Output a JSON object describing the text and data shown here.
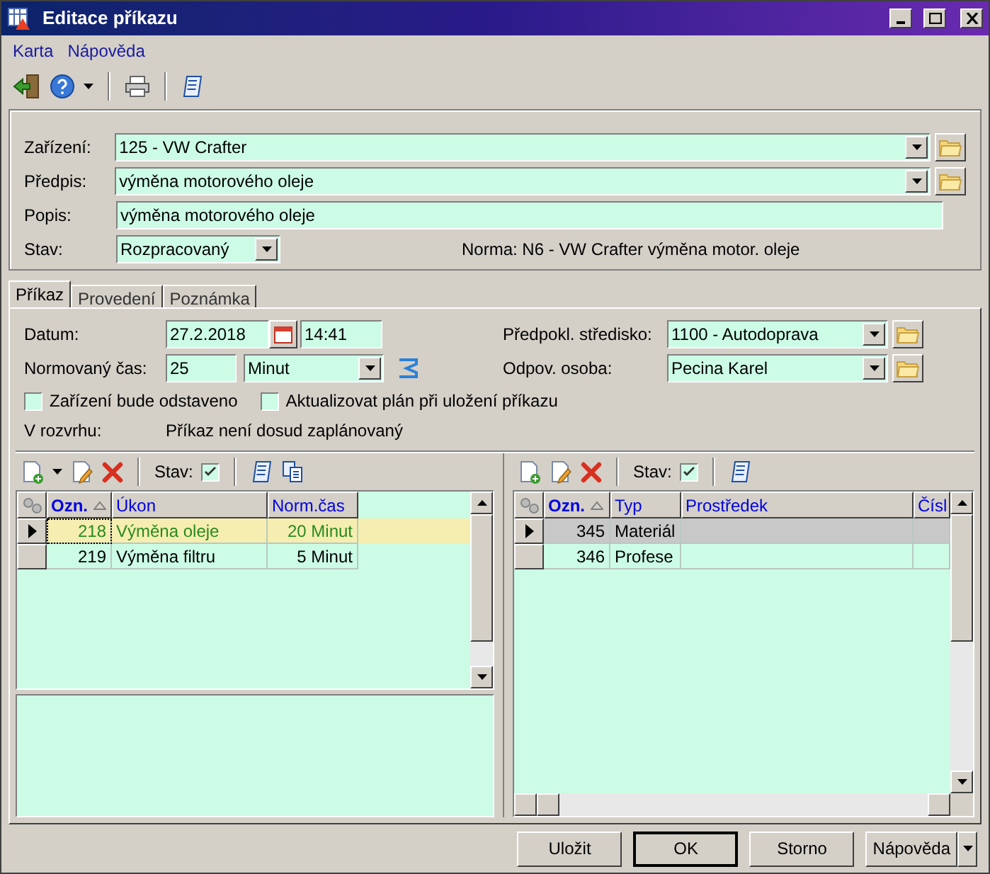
{
  "window": {
    "title": "Editace příkazu"
  },
  "menu": [
    {
      "label": "Karta"
    },
    {
      "label": "Nápověda"
    }
  ],
  "header": {
    "fields": [
      {
        "label": "Zařízení:",
        "value": "125 - VW Crafter",
        "kind": "combo_browse"
      },
      {
        "label": "Předpis:",
        "value": "výměna motorového oleje",
        "kind": "combo_browse"
      },
      {
        "label": "Popis:",
        "value": "výměna motorového oleje",
        "kind": "text"
      }
    ],
    "status": {
      "label": "Stav:",
      "value": "Rozpracovaný"
    },
    "norm": "Norma: N6 - VW Crafter výměna motor. oleje"
  },
  "tabs": [
    {
      "label": "Příkaz",
      "selected": true
    },
    {
      "label": "Provedení",
      "selected": false
    },
    {
      "label": "Poznámka",
      "selected": false
    }
  ],
  "order": {
    "date": {
      "label": "Datum:",
      "date": "27.2.2018",
      "time": "14:41"
    },
    "norm_time": {
      "label": "Normovaný čas:",
      "value": "25",
      "unit": "Minut"
    },
    "right_fields": [
      {
        "label": "Předpokl. středisko:",
        "value": "1100 - Autodoprava"
      },
      {
        "label": "Odpov. osoba:",
        "value": "Pecina Karel"
      }
    ],
    "checkboxes": [
      {
        "label": "Zařízení bude odstaveno",
        "checked": false
      },
      {
        "label": "Aktualizovat plán při uložení příkazu",
        "checked": false
      }
    ],
    "schedule": {
      "label": "V rozvrhu:",
      "value": "Příkaz není dosud zaplánovaný"
    }
  },
  "grids": [
    {
      "active": true,
      "toolbar": {
        "stav_label": "Stav:",
        "stav_checked": true
      },
      "columns": [
        {
          "label": "Ozn.",
          "sorted": true,
          "kind": "number"
        },
        {
          "label": "Úkon",
          "sorted": false,
          "kind": "text"
        },
        {
          "label": "Norm.čas",
          "sorted": false,
          "kind": "number"
        }
      ],
      "rows": [
        {
          "cells": [
            "218",
            "Výměna oleje",
            "20 Minut"
          ],
          "selected": true
        },
        {
          "cells": [
            "219",
            "Výměna filtru",
            "5 Minut"
          ],
          "selected": false
        }
      ]
    },
    {
      "active": false,
      "toolbar": {
        "stav_label": "Stav:",
        "stav_checked": true
      },
      "columns": [
        {
          "label": "Ozn.",
          "sorted": true,
          "kind": "number"
        },
        {
          "label": "Typ",
          "sorted": false,
          "kind": "text"
        },
        {
          "label": "Prostředek",
          "sorted": false,
          "kind": "text"
        },
        {
          "label": "Čísl",
          "kind": "text"
        }
      ],
      "rows": [
        {
          "cells": [
            "345",
            "Materiál",
            "",
            ""
          ],
          "selected": true
        },
        {
          "cells": [
            "346",
            "Profese",
            "",
            ""
          ],
          "selected": false
        }
      ]
    }
  ],
  "buttons": [
    {
      "label": "Uložit",
      "kind": "plain"
    },
    {
      "label": "OK",
      "kind": "default"
    },
    {
      "label": "Storno",
      "kind": "plain"
    },
    {
      "label": "Nápověda",
      "kind": "split"
    }
  ]
}
